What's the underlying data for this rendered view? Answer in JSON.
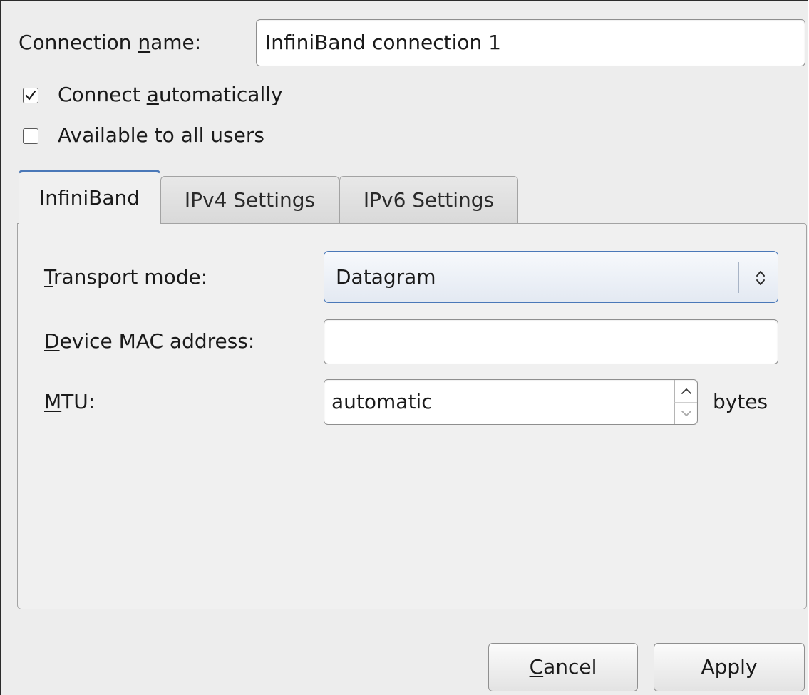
{
  "connection_name": {
    "label_before": "Connection ",
    "label_mnemonic": "n",
    "label_after": "ame:",
    "value": "InfiniBand connection 1"
  },
  "connect_automatically": {
    "label_before": "Connect ",
    "label_mnemonic": "a",
    "label_after": "utomatically",
    "checked": true
  },
  "available_to_all_users": {
    "label": "Available to all users",
    "checked": false
  },
  "tabs": [
    {
      "label": "InfiniBand",
      "active": true
    },
    {
      "label": "IPv4 Settings",
      "active": false
    },
    {
      "label": "IPv6 Settings",
      "active": false
    }
  ],
  "infiniband": {
    "transport_mode": {
      "label_mnemonic": "T",
      "label_after": "ransport mode:",
      "selected": "Datagram"
    },
    "device_mac": {
      "label_mnemonic": "D",
      "label_after": "evice MAC address:",
      "value": ""
    },
    "mtu": {
      "label_mnemonic": "M",
      "label_after": "TU:",
      "value": "automatic",
      "unit": "bytes"
    }
  },
  "buttons": {
    "cancel": {
      "label_mnemonic": "C",
      "label_after": "ancel"
    },
    "apply": {
      "label": "Apply"
    }
  },
  "colors": {
    "dialog_bg": "#ededed",
    "focus_accent": "#4a78b8"
  },
  "icons": {
    "check": "check-mark-icon",
    "combo_arrows": "up-down-chevron-icon",
    "spin_up": "arrow-up-icon",
    "spin_down": "arrow-down-icon"
  }
}
